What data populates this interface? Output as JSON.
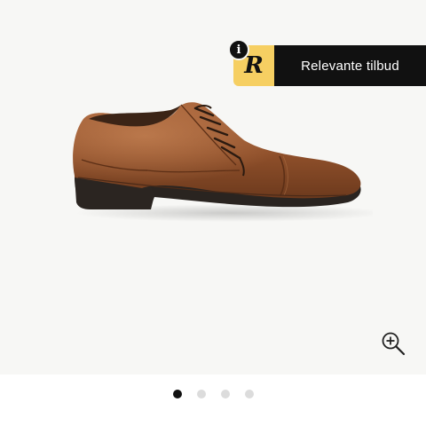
{
  "promo": {
    "info_symbol": "i",
    "logo_letter": "R",
    "label": "Relevante tilbud",
    "logo_color": "#f6cf62"
  },
  "gallery": {
    "image_name": "brown-leather-derby-shoe",
    "zoom_icon": "zoom-in-icon",
    "slide_count": 4,
    "active_slide": 1
  }
}
